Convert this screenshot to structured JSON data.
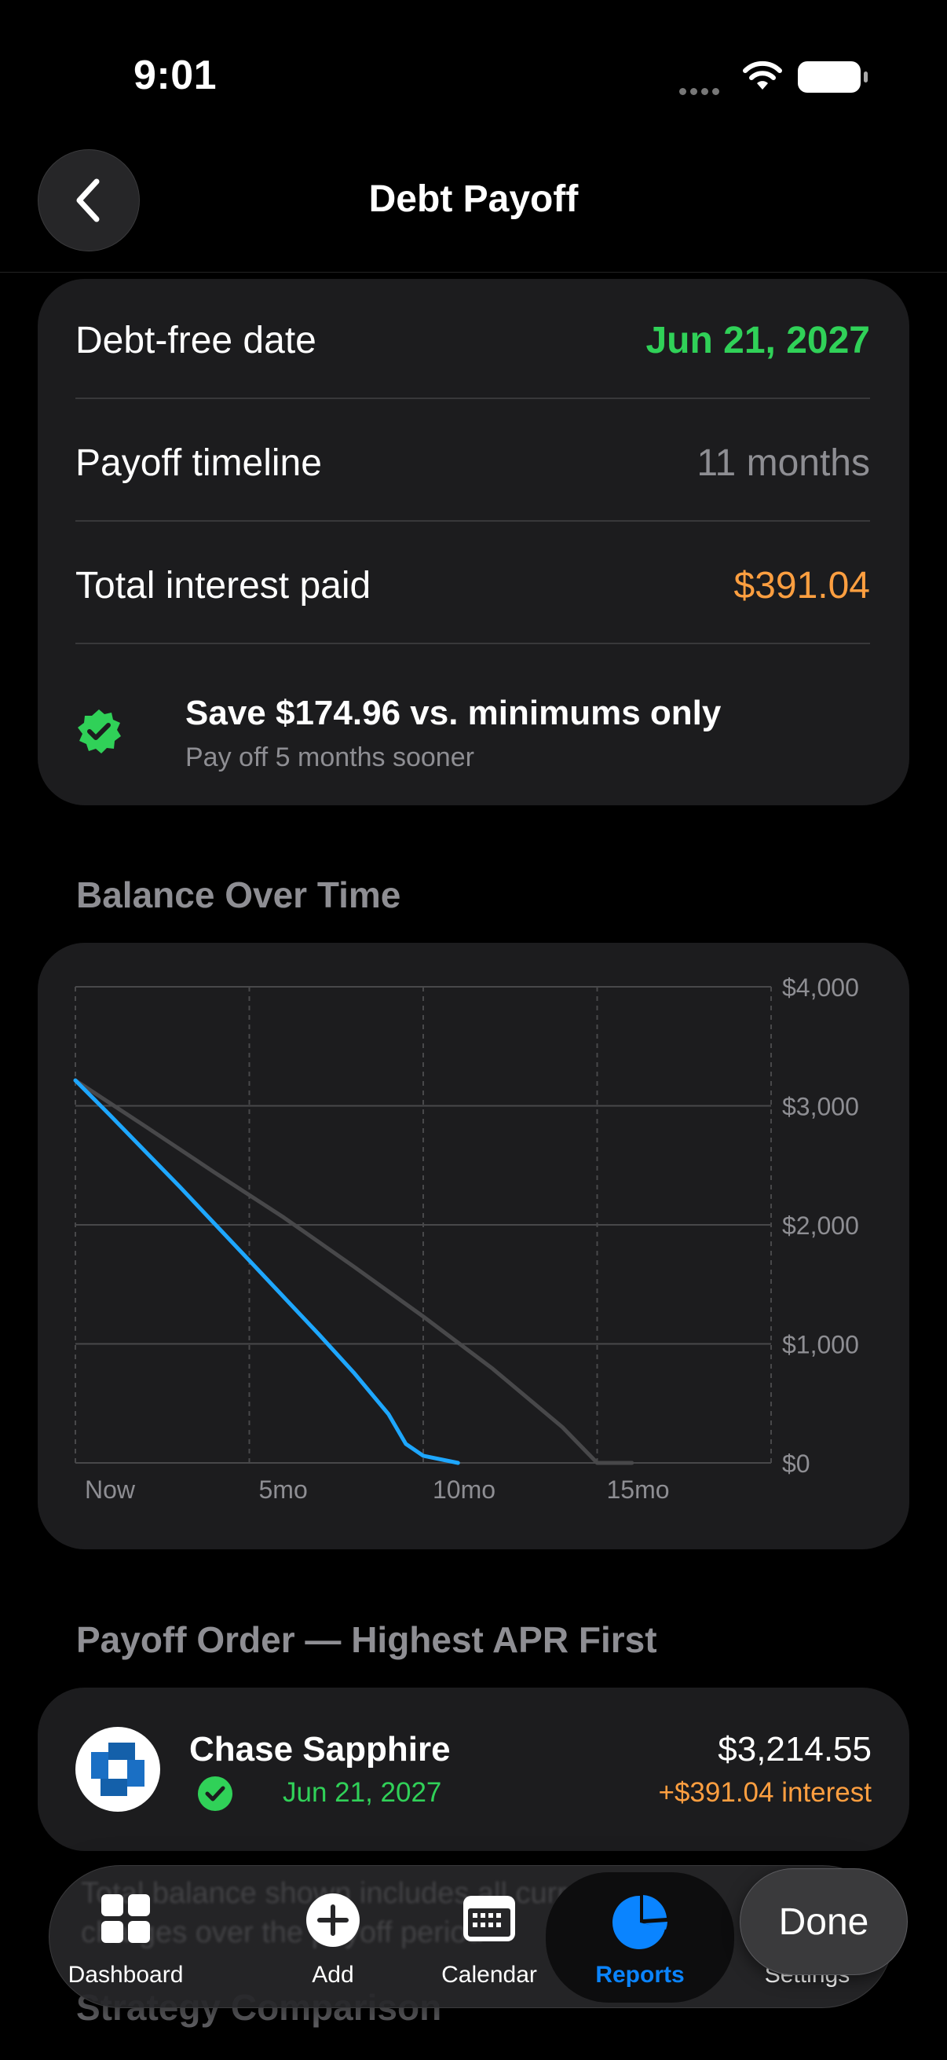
{
  "status_bar": {
    "time": "9:01"
  },
  "nav": {
    "title": "Debt Payoff",
    "back_icon": "chevron-left-icon"
  },
  "summary": {
    "debt_free_label": "Debt-free date",
    "debt_free_value": "Jun 21, 2027",
    "timeline_label": "Payoff timeline",
    "timeline_value": "11 months",
    "interest_label": "Total interest paid",
    "interest_value": "$391.04",
    "savings_title": "Save $174.96 vs. minimums only",
    "savings_subtitle": "Pay off 5 months sooner",
    "colors": {
      "positive": "#30d158",
      "interest": "#ff9f40"
    }
  },
  "balance_section": {
    "title": "Balance Over Time"
  },
  "chart_data": {
    "type": "line",
    "x_tick_labels": [
      "Now",
      "5mo",
      "10mo",
      "15mo"
    ],
    "y_tick_labels": [
      "$4,000",
      "$3,000",
      "$2,000",
      "$1,000",
      "$0"
    ],
    "x_range": [
      0,
      20
    ],
    "ylim": [
      0,
      4000
    ],
    "grid": true,
    "series": [
      {
        "color": "#1ea7ff",
        "x": [
          0,
          1,
          2,
          3,
          4,
          5,
          6,
          7,
          8,
          9,
          9.5,
          10,
          11
        ],
        "y": [
          3214,
          2920,
          2620,
          2320,
          2010,
          1700,
          1390,
          1080,
          760,
          410,
          160,
          60,
          0
        ]
      },
      {
        "color": "#48484a",
        "x": [
          0,
          2,
          4,
          6,
          8,
          10,
          12,
          14,
          15,
          16
        ],
        "y": [
          3214,
          2830,
          2440,
          2060,
          1650,
          1230,
          790,
          300,
          0,
          0
        ]
      }
    ]
  },
  "payoff_order": {
    "title": "Payoff Order — Highest APR First",
    "items": [
      {
        "name": "Chase Sapphire",
        "date": "Jun 21, 2027",
        "balance": "$3,214.55",
        "interest": "+$391.04 interest"
      }
    ]
  },
  "next_section": {
    "title": "Strategy Comparison"
  },
  "tab_bar": {
    "ghost_line_1": "Total balance shown includes all current",
    "ghost_line_2": "charges over the payoff period",
    "tabs": [
      {
        "label": "Dashboard",
        "icon": "grid-icon"
      },
      {
        "label": "Add",
        "icon": "plus-circle-icon"
      },
      {
        "label": "Calendar",
        "icon": "calendar-icon"
      },
      {
        "label": "Reports",
        "icon": "pie-chart-icon"
      },
      {
        "label": "Settings",
        "icon": "gear-icon"
      }
    ],
    "active_tab": "Reports",
    "active_color": "#0a84ff"
  },
  "done_button": {
    "label": "Done"
  }
}
